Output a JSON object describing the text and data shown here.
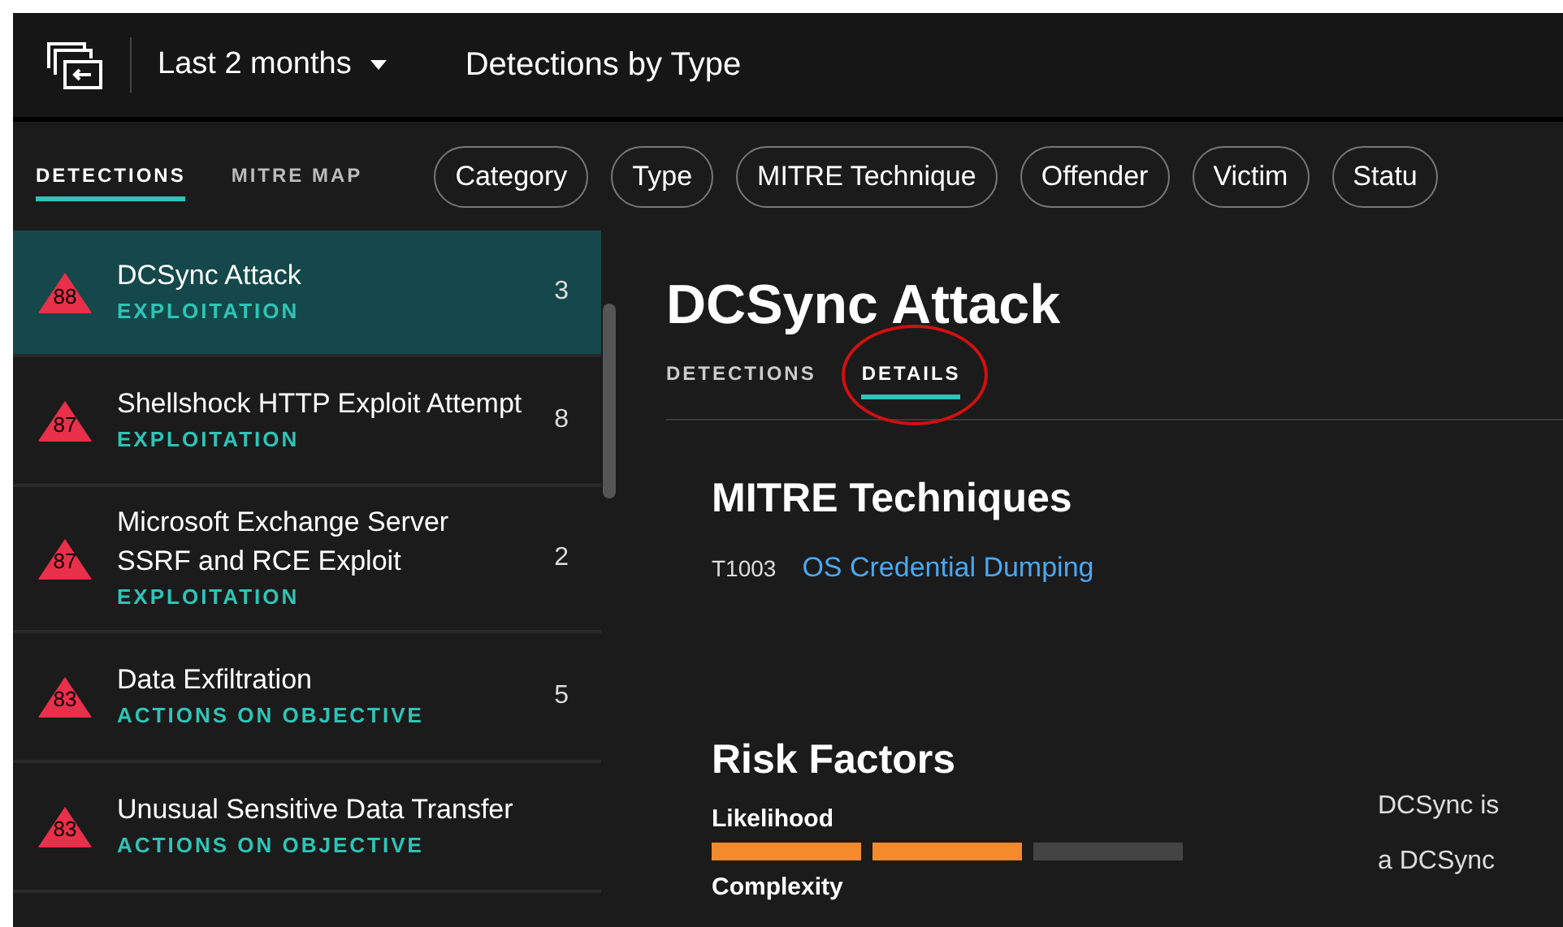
{
  "header": {
    "time_range": "Last 2 months",
    "title": "Detections by Type"
  },
  "nav_tabs": [
    {
      "label": "DETECTIONS",
      "selected": true
    },
    {
      "label": "MITRE MAP",
      "selected": false
    }
  ],
  "filters": [
    "Category",
    "Type",
    "MITRE Technique",
    "Offender",
    "Victim",
    "Statu"
  ],
  "detections": [
    {
      "risk": "88",
      "name": "DCSync Attack",
      "category": "EXPLOITATION",
      "count": "3",
      "selected": true
    },
    {
      "risk": "87",
      "name": "Shellshock HTTP Exploit Attempt",
      "category": "EXPLOITATION",
      "count": "8",
      "selected": false
    },
    {
      "risk": "87",
      "name": "Microsoft Exchange Server SSRF and RCE Exploit",
      "category": "EXPLOITATION",
      "count": "2",
      "selected": false
    },
    {
      "risk": "83",
      "name": "Data Exfiltration",
      "category": "ACTIONS ON OBJECTIVE",
      "count": "5",
      "selected": false
    },
    {
      "risk": "83",
      "name": "Unusual Sensitive Data Transfer",
      "category": "ACTIONS ON OBJECTIVE",
      "selected": false
    }
  ],
  "detail": {
    "title": "DCSync Attack",
    "tabs": [
      {
        "label": "DETECTIONS",
        "selected": false
      },
      {
        "label": "DETAILS",
        "selected": true,
        "circled": true
      }
    ],
    "mitre_heading": "MITRE Techniques",
    "techniques": [
      {
        "id": "T1003",
        "name": "OS Credential Dumping"
      }
    ],
    "risk_heading": "Risk Factors",
    "risk_factors": [
      {
        "label": "Likelihood",
        "level": 0.67
      },
      {
        "label": "Complexity"
      }
    ],
    "description_lines": [
      "DCSync is",
      "a DCSync"
    ]
  }
}
